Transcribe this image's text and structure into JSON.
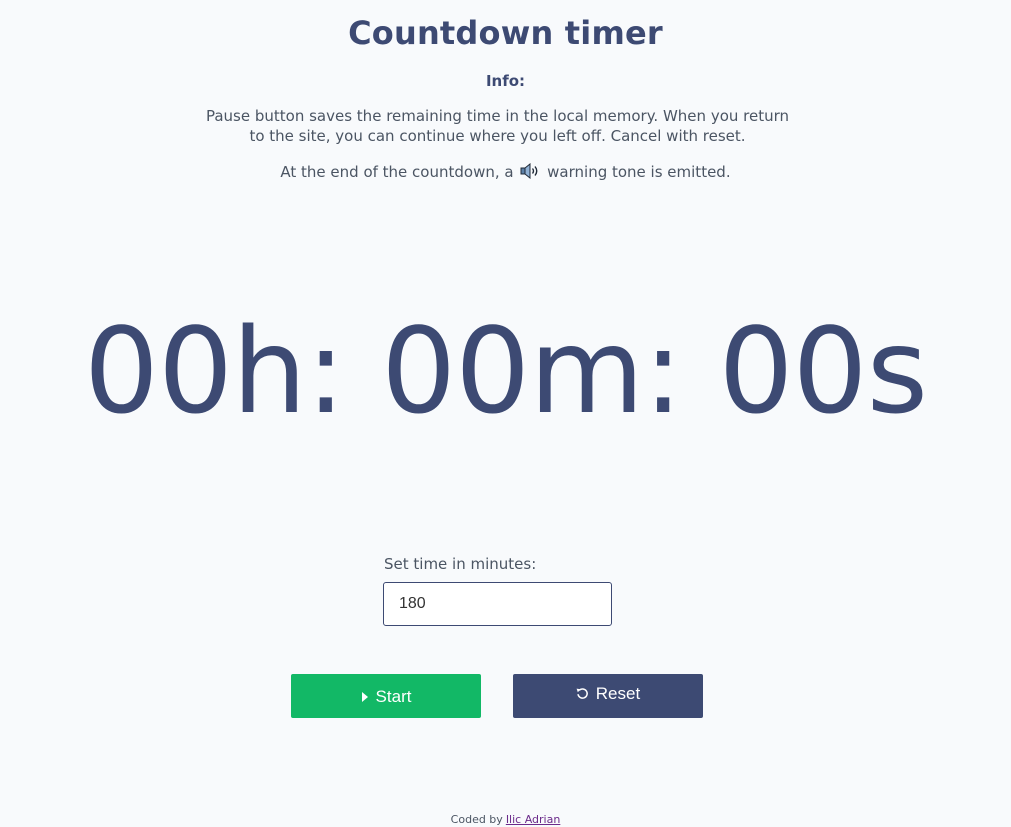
{
  "header": {
    "title": "Countdown timer",
    "info_heading": "Info:",
    "info_paragraph": "Pause button saves the remaining time in the local memory. When you return to the site, you can continue where you left off. Cancel with reset.",
    "tone_text_before": "At the end of the countdown, a",
    "tone_text_after": "warning tone is emitted."
  },
  "timer": {
    "display": "00h: 00m: 00s",
    "hours": "00",
    "minutes": "00",
    "seconds": "00"
  },
  "form": {
    "label": "Set time in minutes:",
    "value": "180"
  },
  "controls": {
    "start_label": "Start",
    "reset_label": "Reset",
    "start_icon": "play-icon",
    "reset_icon": "reset-icon"
  },
  "footer": {
    "text": "Coded by",
    "link_text": "Ilic Adrian"
  },
  "colors": {
    "primary": "#3d4a73",
    "start_green": "#12b866",
    "background": "#f8fafc"
  }
}
